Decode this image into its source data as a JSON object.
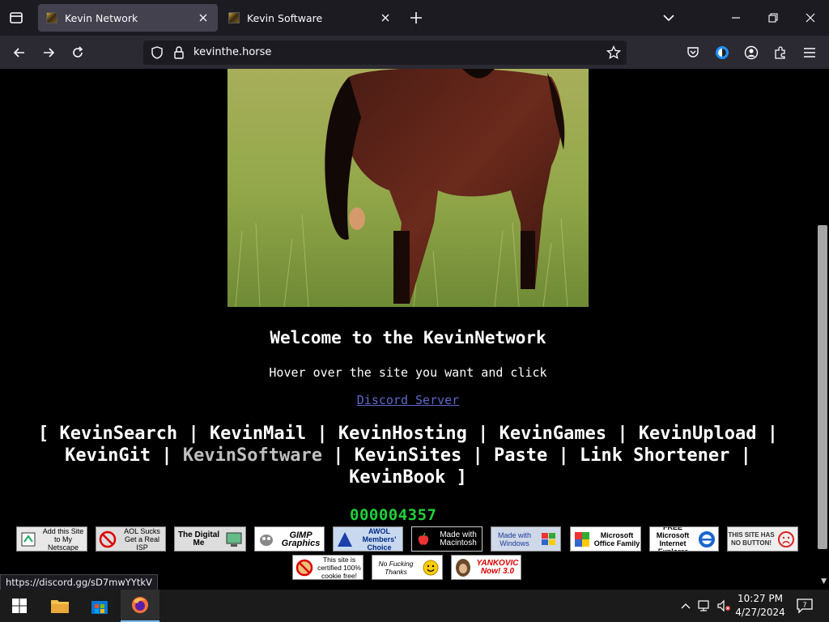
{
  "browser": {
    "tabs": [
      {
        "title": "Kevin Network",
        "active": true
      },
      {
        "title": "Kevin Software",
        "active": false
      }
    ],
    "url": "kevinthe.horse"
  },
  "page": {
    "welcome": "Welcome to the KevinNetwork",
    "hover_text": "Hover over the site you want and click",
    "discord_link": "Discord Server",
    "links_open": "[",
    "links_close": "]",
    "separator": "|",
    "links": [
      "KevinSearch",
      "KevinMail",
      "KevinHosting",
      "KevinGames",
      "KevinUpload",
      "KevinGit",
      "KevinSoftware",
      "KevinSites",
      "Paste",
      "Link Shortener",
      "KevinBook"
    ],
    "hit_counter": "000004357",
    "badges_row1": [
      {
        "text": "Add this Site to My Netscape",
        "icon": "netscape-icon"
      },
      {
        "text": "AOL Sucks Get a Real ISP",
        "icon": "no-aol-icon"
      },
      {
        "text": "The Digital Me",
        "icon": "computer-icon"
      },
      {
        "text": "GIMP Graphics",
        "icon": "gimp-icon"
      },
      {
        "text": "AWOL Members' Choice",
        "icon": "awol-icon"
      },
      {
        "text": "Made with Macintosh",
        "icon": "apple-icon"
      },
      {
        "text": "Made with Windows",
        "icon": "windows-flag-icon"
      },
      {
        "text": "Microsoft Office Family",
        "icon": "office-icon"
      },
      {
        "text": "FREE Microsoft Internet Explorer",
        "icon": "ie-icon"
      },
      {
        "text": "THIS SITE HAS NO BUTTON!",
        "icon": "sad-face-icon"
      }
    ],
    "badges_row2": [
      {
        "text": "This site is certified 100% cookie free!",
        "icon": "no-cookie-icon"
      },
      {
        "text": "No Fucking Thanks",
        "icon": "smiley-icon"
      },
      {
        "text": "YANKOVIC Now! 3.0",
        "icon": "yankovic-icon"
      }
    ],
    "status_url": "https://discord.gg/sD7mwYYtkV"
  },
  "taskbar": {
    "time": "10:27 PM",
    "date": "4/27/2024",
    "notifications": "7"
  },
  "colors": {
    "link": "#5f67c9",
    "counter": "#22d03a",
    "tab_active": "#42414d"
  }
}
